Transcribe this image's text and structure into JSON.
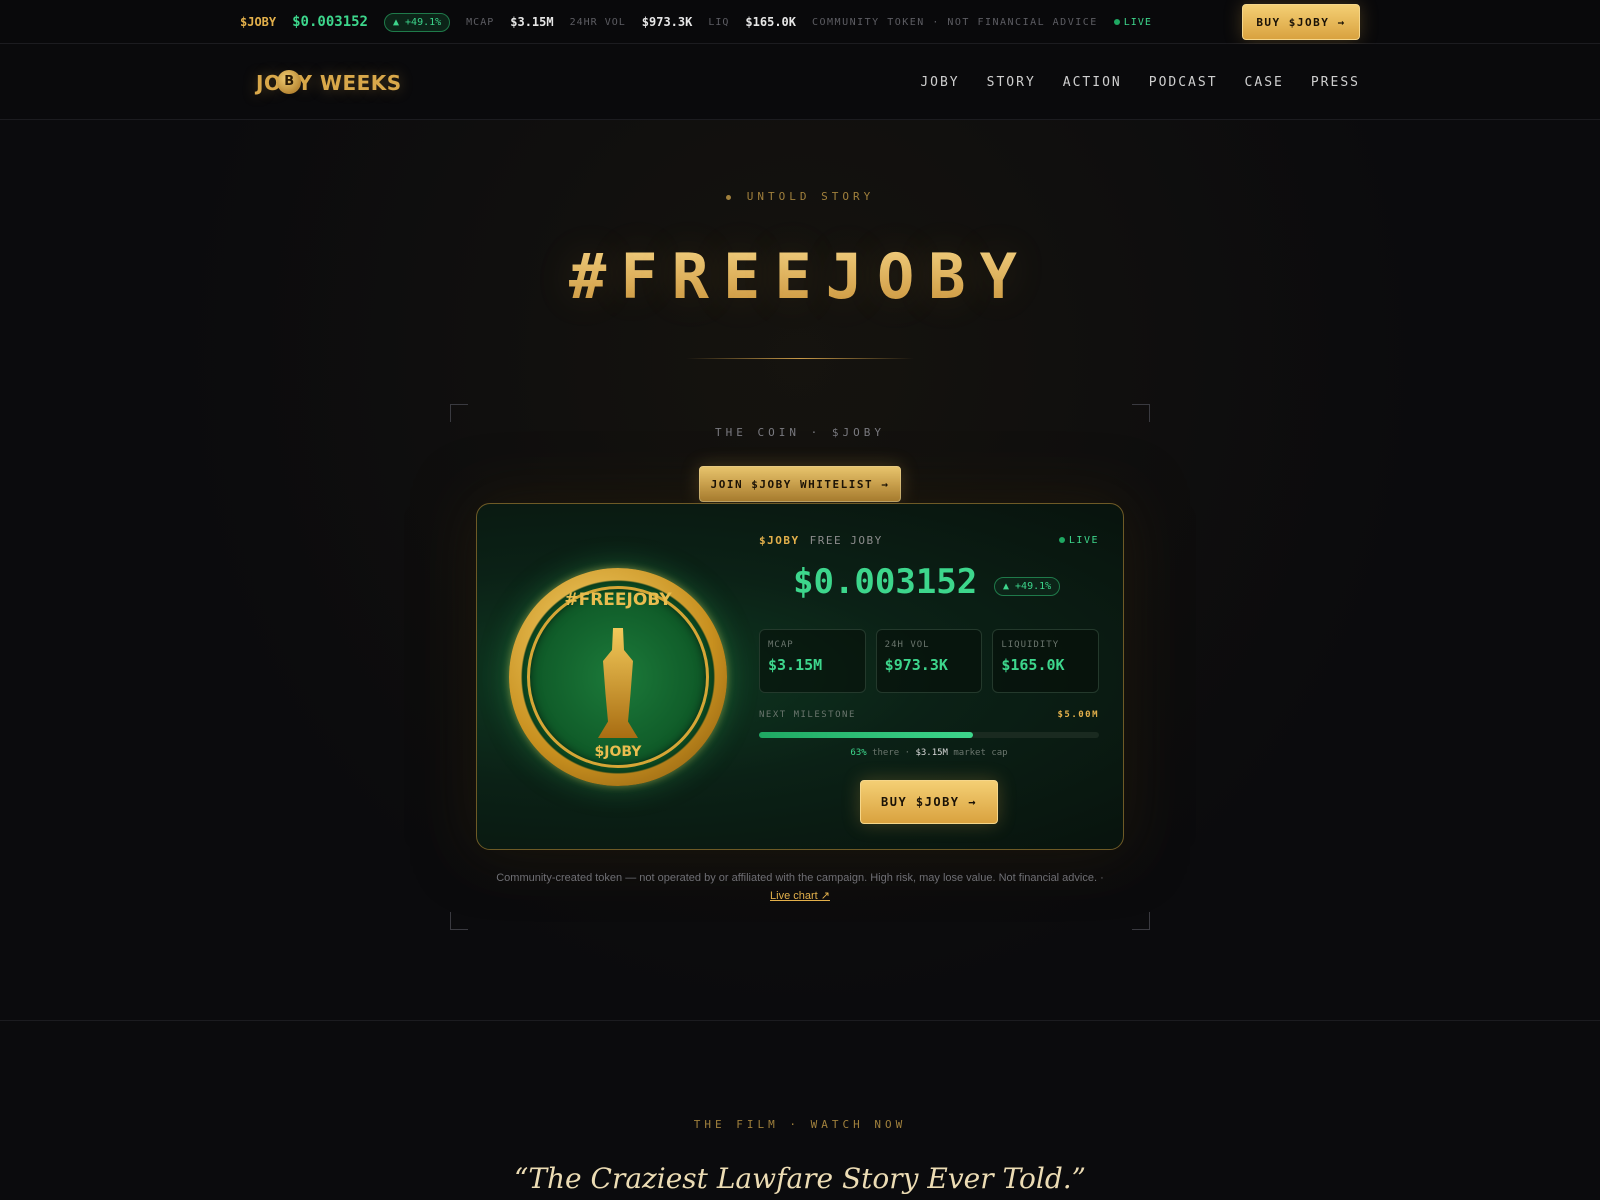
{
  "ticker": {
    "symbol": "$JOBY",
    "price": "$0.003152",
    "change": "▲ +49.1%",
    "mcap_label": "MCAP",
    "mcap_value": "$3.15M",
    "vol_label": "24HR VOL",
    "vol_value": "$973.3K",
    "liq_label": "LIQ",
    "liq_value": "$165.0K",
    "note": "COMMUNITY TOKEN · NOT FINANCIAL ADVICE",
    "live": "LIVE",
    "buy_label": "BUY $JOBY →"
  },
  "nav": {
    "logo_left": "JO",
    "logo_coin": "B",
    "logo_right": "Y WEEKS",
    "links": [
      "JOBY",
      "STORY",
      "ACTION",
      "PODCAST",
      "CASE",
      "PRESS"
    ]
  },
  "hero": {
    "eyebrow": "UNTOLD STORY",
    "title": "#FREEJOBY"
  },
  "coin_section": {
    "eyebrow": "THE COIN · $JOBY",
    "whitelist_label": "JOIN $JOBY WHITELIST →",
    "card": {
      "symbol": "$JOBY",
      "name": "FREE JOBY",
      "live": "LIVE",
      "coin_text_top": "#FREEJOBY",
      "coin_text_bottom": "$JOBY",
      "price": "$0.003152",
      "change": "▲ +49.1%",
      "stats": [
        {
          "label": "MCAP",
          "value": "$3.15M"
        },
        {
          "label": "24H VOL",
          "value": "$973.3K"
        },
        {
          "label": "LIQUIDITY",
          "value": "$165.0K"
        }
      ],
      "milestone_label": "NEXT MILESTONE",
      "milestone_target": "$5.00M",
      "milestone_progress": 0.63,
      "milestone_pct": "63%",
      "milestone_there": " there · ",
      "milestone_cap": "$3.15M",
      "milestone_cap_suffix": " market cap",
      "buy_label": "BUY $JOBY →"
    },
    "disclaimer": "Community-created token — not operated by or affiliated with the campaign. High risk, may lose value. Not financial advice. ·",
    "live_chart": "Live chart ↗"
  },
  "film": {
    "eyebrow": "THE FILM · WATCH NOW",
    "quote": "“The Craziest Lawfare Story Ever Told.”"
  },
  "colors": {
    "gold": "#e3b04b",
    "green": "#3dd68c",
    "background": "#0b0b0d"
  }
}
